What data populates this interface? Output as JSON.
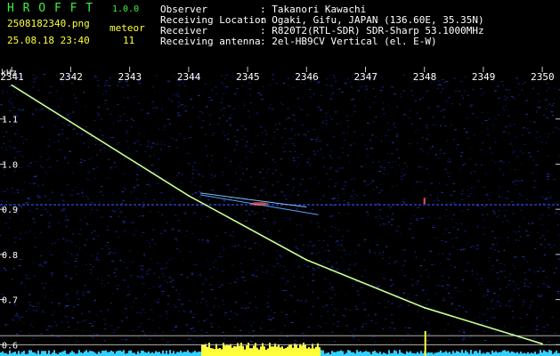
{
  "app": {
    "name": "H R O F F T",
    "version": "1.0.0",
    "filename": "2508182340.png",
    "mode_label": "meteor",
    "timestamp": "25.08.18 23:40",
    "count": "11"
  },
  "station": {
    "observer_label": "Observer",
    "observer_value": ": Takanori Kawachi",
    "location_label": "Receiving Location",
    "location_value": ": Ogaki, Gifu, JAPAN (136.60E, 35.35N)",
    "receiver_label": "Receiver",
    "receiver_value": ": R820T2(RTL-SDR) SDR-Sharp 53.1000MHz",
    "antenna_label": "Receiving antenna",
    "antenna_value": ": 2el-HB9CV Vertical (el. E-W)"
  },
  "colors": {
    "background": "#000000",
    "green_text": "#3cf03c",
    "yellow_text": "#ffff3c",
    "grid": "#c8c8c8",
    "trace": "#c8ff96",
    "noise": "#1a2a9a"
  },
  "chart_data": {
    "type": "scatter",
    "title": "",
    "xlabel": "",
    "ylabel": "kHz",
    "x_ticks": [
      "2341",
      "2342",
      "2343",
      "2344",
      "2345",
      "2346",
      "2347",
      "2348",
      "2349",
      "2350"
    ],
    "y_ticks": [
      "1.1",
      "1.0",
      "0.9",
      "0.8",
      "0.7",
      "0.6"
    ],
    "xlim": [
      2340.8,
      2350.3
    ],
    "ylim": [
      0.575,
      1.2
    ],
    "grid": false,
    "series": [
      {
        "x": [
          2341.0,
          2344.0,
          2346.0,
          2348.0,
          2350.0
        ],
        "y": [
          1.175,
          0.93,
          0.788,
          0.682,
          0.602
        ]
      }
    ],
    "carrier_khz": 0.91,
    "reference_lines_khz": [
      0.62,
      0.6
    ]
  }
}
